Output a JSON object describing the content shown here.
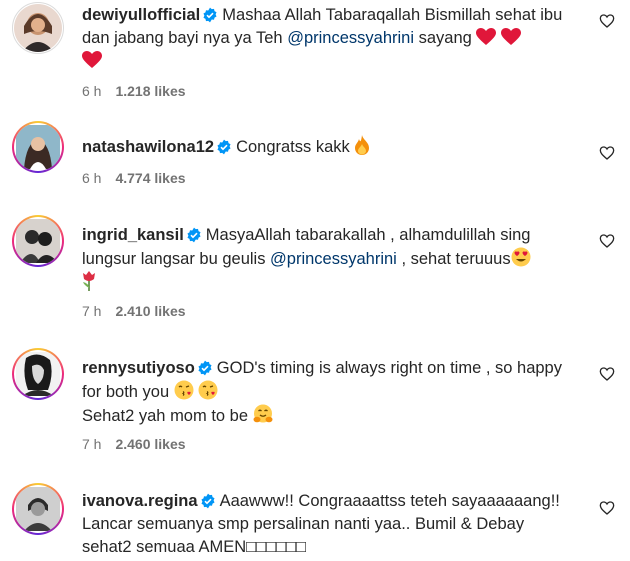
{
  "comments": [
    {
      "username": "dewiyullofficial",
      "text_before": "Mashaa Allah Tabaraqallah Bismillah sehat ibu dan jabang bayi nya ya Teh",
      "mention": "@princessyahrini",
      "text_after": "sayang",
      "emojis": [
        "red-heart",
        "red-heart",
        "red-heart"
      ],
      "time": "6 h",
      "likes": "1.218 likes"
    },
    {
      "username": "natashawilona12",
      "text": "Congratss kakk",
      "emojis": [
        "fire"
      ],
      "time": "6 h",
      "likes": "4.774 likes"
    },
    {
      "username": "ingrid_kansil",
      "text_before": "MasyaAllah tabarakallah , alhamdulillah sing lungsur langsar bu geulis",
      "mention": "@princessyahrini",
      "text_after": ", sehat teruuus",
      "emojis": [
        "heart-eyes",
        "tulip"
      ],
      "time": "7 h",
      "likes": "2.410 likes"
    },
    {
      "username": "rennysutiyoso",
      "line1": "GOD's timing is always right on time , so happy for both you",
      "line2": "Sehat2 yah mom to be",
      "emojis": [
        "kissing-face",
        "kissing-face",
        "hugging-face"
      ],
      "time": "7 h",
      "likes": "2.460 likes"
    },
    {
      "username": "ivanova.regina",
      "text": "Aaawww!! Congraaaattss teteh sayaaaaaang!! Lancar semuanya smp persalinan nanti yaa.. Bumil & Debay sehat2 semuaa AMEN□□□□□□"
    }
  ],
  "colors": {
    "text": "#262626",
    "secondary": "#737373",
    "mention": "#00376b",
    "verified": "#0095f6"
  },
  "icons": {
    "verified": "verified-badge-icon",
    "like": "heart-outline-icon"
  }
}
